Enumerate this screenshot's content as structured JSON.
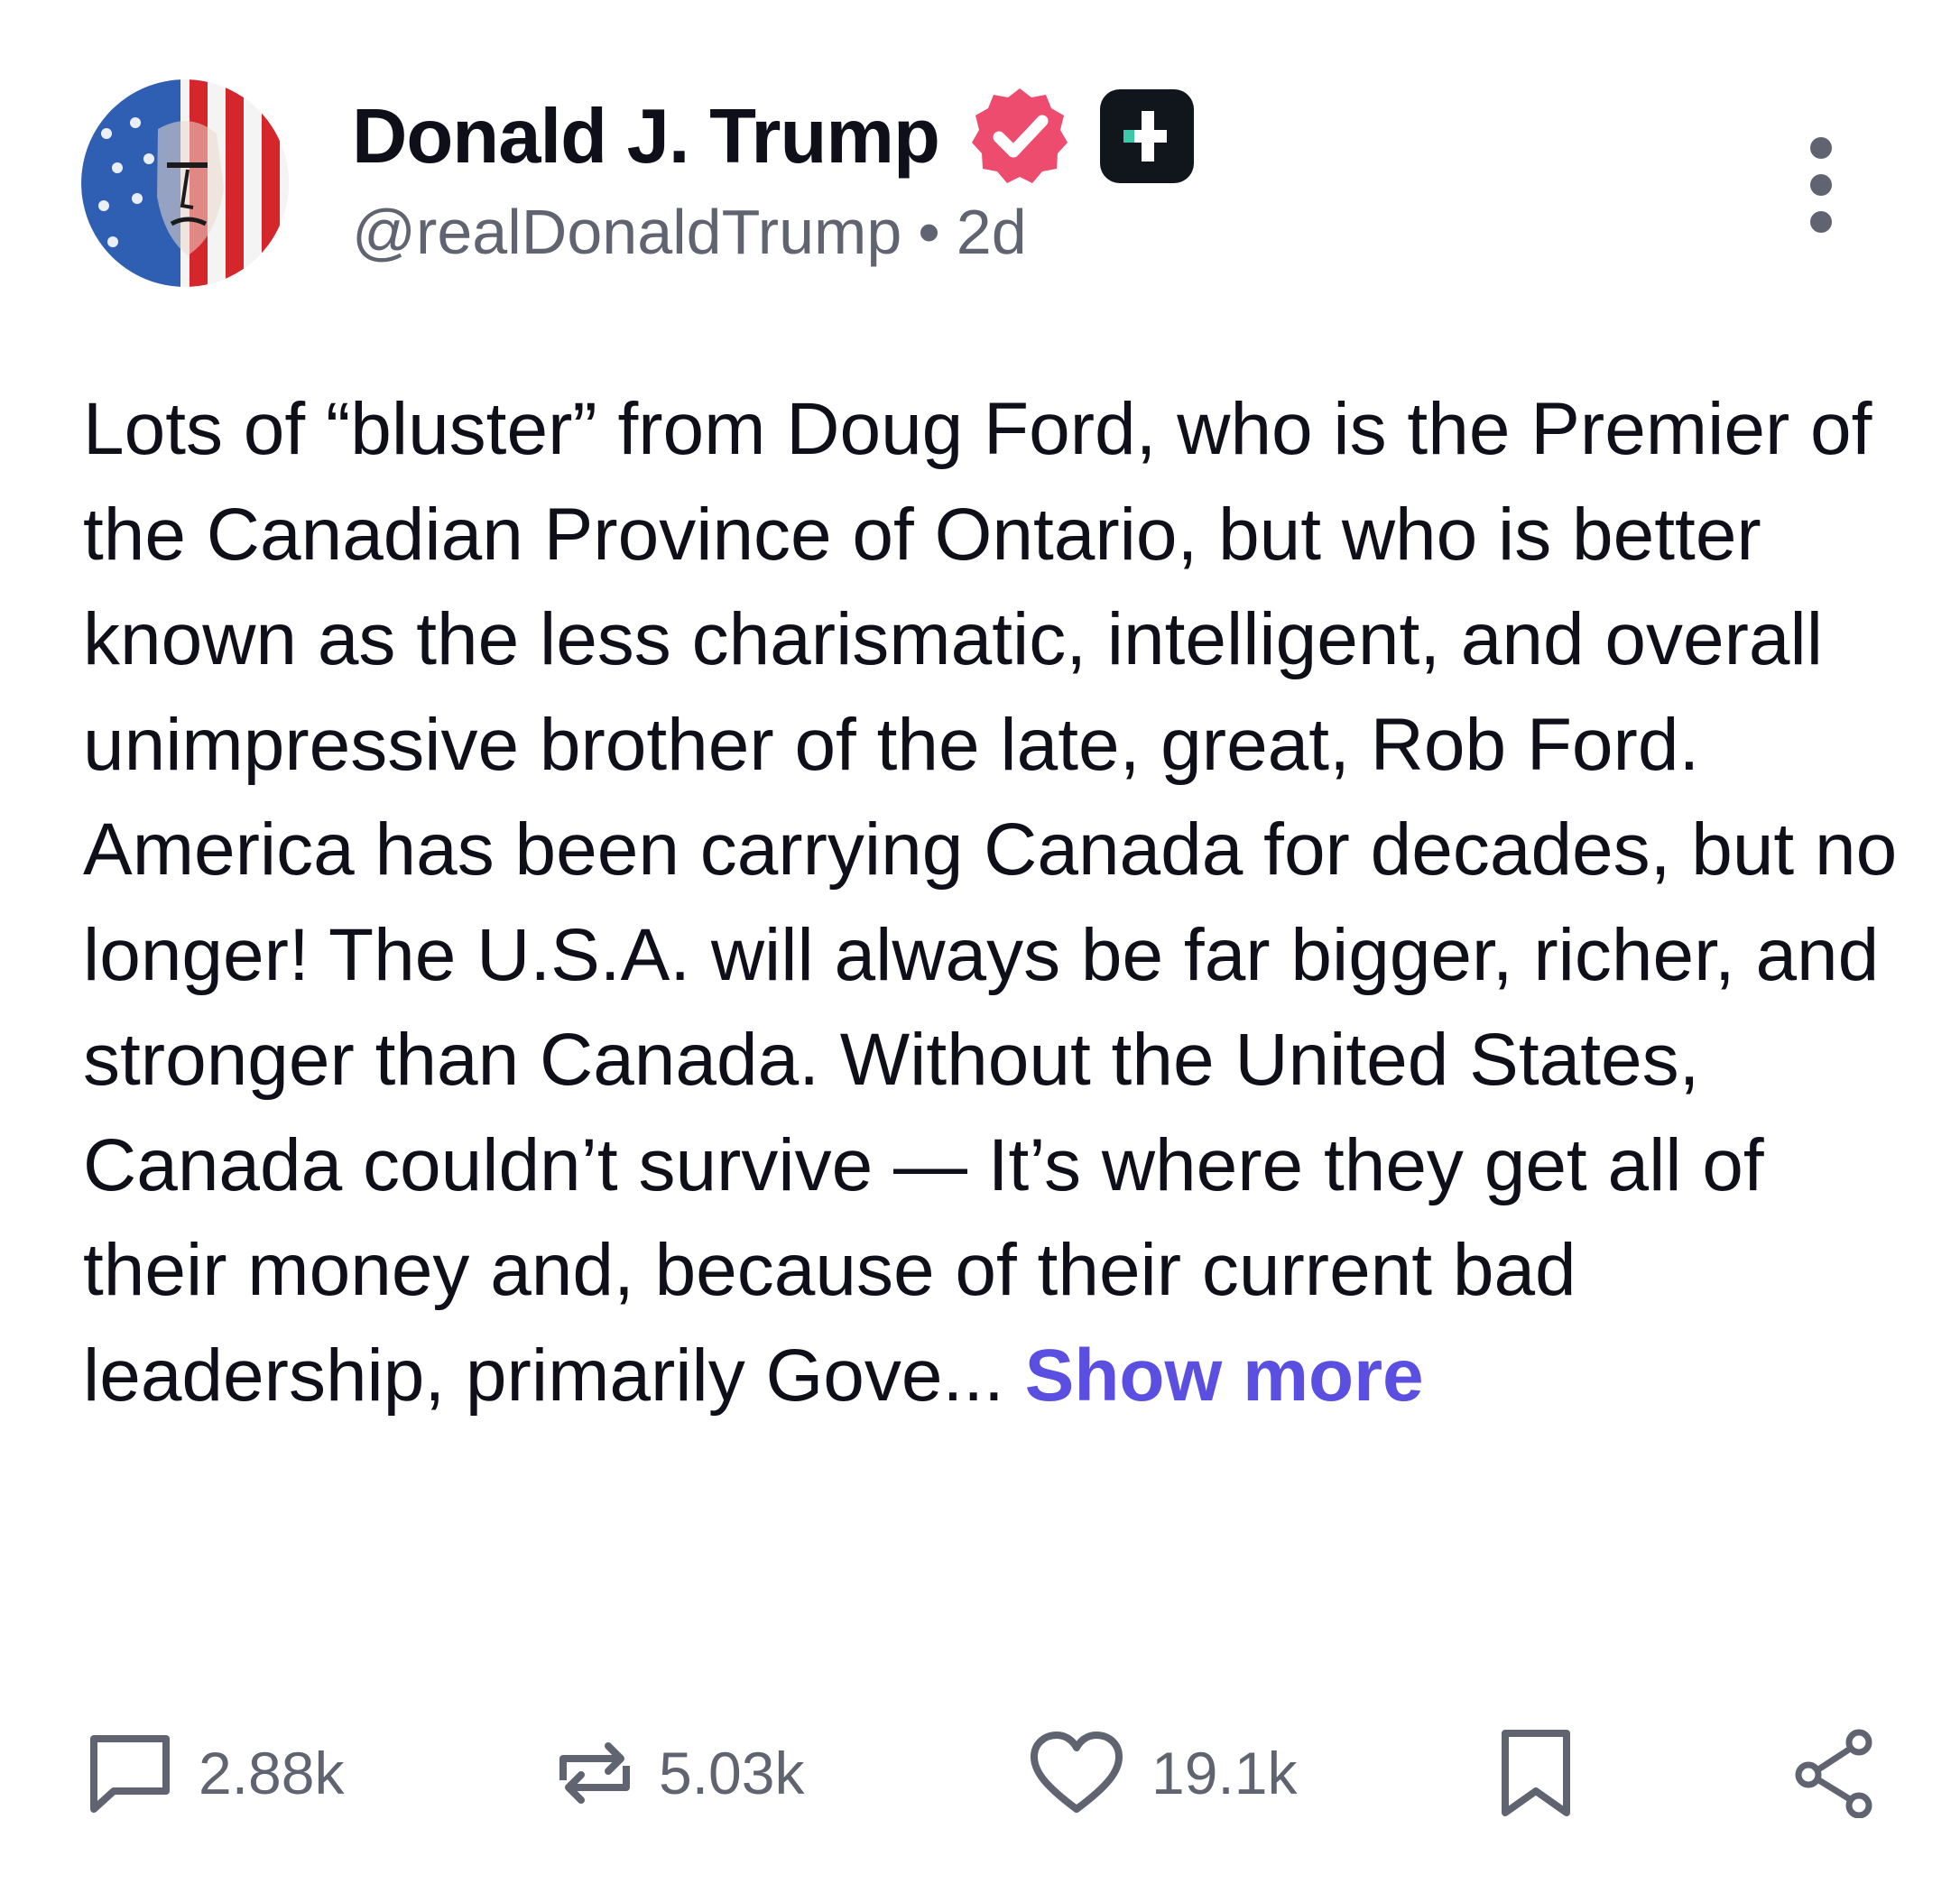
{
  "post": {
    "author": {
      "display_name": "Donald J. Trump",
      "handle": "@realDonaldTrump",
      "separator": "•",
      "age": "2d",
      "avatar_icon": "flag-portrait-avatar",
      "verified_icon": "verified-badge-icon",
      "plus_icon": "plus-badge-icon"
    },
    "text": "Lots of “bluster” from Doug Ford, who is the Premier of the Canadian Province of Ontario, but who is better known as the less charismatic, intelligent, and overall unimpressive brother of the late, great, Rob Ford. America has been carrying Canada for decades, but no longer! The U.S.A. will always be far bigger, richer, and stronger than Canada. Without the United States, Canada couldn’t survive — It’s where they get all of their money and, because of their current bad leadership, primarily Gove...",
    "show_more_label": "Show more",
    "actions": {
      "replies": "2.88k",
      "reposts": "5.03k",
      "likes": "19.1k"
    },
    "icons": {
      "more": "more-vertical-icon",
      "reply": "reply-icon",
      "repost": "repost-icon",
      "like": "heart-icon",
      "bookmark": "bookmark-icon",
      "share": "share-icon"
    }
  },
  "colors": {
    "accent": "#5a4fe0",
    "verified": "#ee4c6e",
    "text_primary": "#0f0f1a",
    "text_secondary": "#5f6470"
  }
}
